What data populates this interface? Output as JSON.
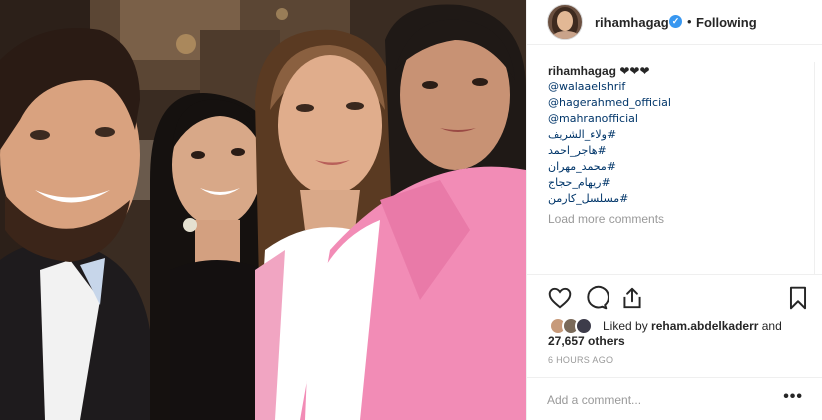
{
  "post": {
    "author": "rihamhagag",
    "follow_status": "Following",
    "dot": "•",
    "verified_mark": "✓"
  },
  "caption": {
    "user": "rihamhagag",
    "hearts": "❤❤❤",
    "tags": [
      "@walaaelshrif",
      "@hagerahmed_official",
      "@mahranofficial",
      "#ولاء_الشريف",
      "#هاجر_احمد",
      "#محمد_مهران",
      "#ريهام_حجاج",
      "#مسلسل_كارمن"
    ],
    "load_more": "Load more comments"
  },
  "likes": {
    "prefix": "Liked by ",
    "user": "reham.abdelkaderr",
    "and": " and",
    "others": "27,657 others"
  },
  "timestamp": "6 HOURS AGO",
  "comment": {
    "placeholder": "Add a comment...",
    "more": "•••"
  },
  "icons": {
    "like": "heart-icon",
    "comment": "comment-icon",
    "share": "share-icon",
    "save": "bookmark-icon"
  },
  "colors": {
    "link": "#003569",
    "verified": "#3897f0",
    "muted": "#999999",
    "border": "#efefef"
  }
}
